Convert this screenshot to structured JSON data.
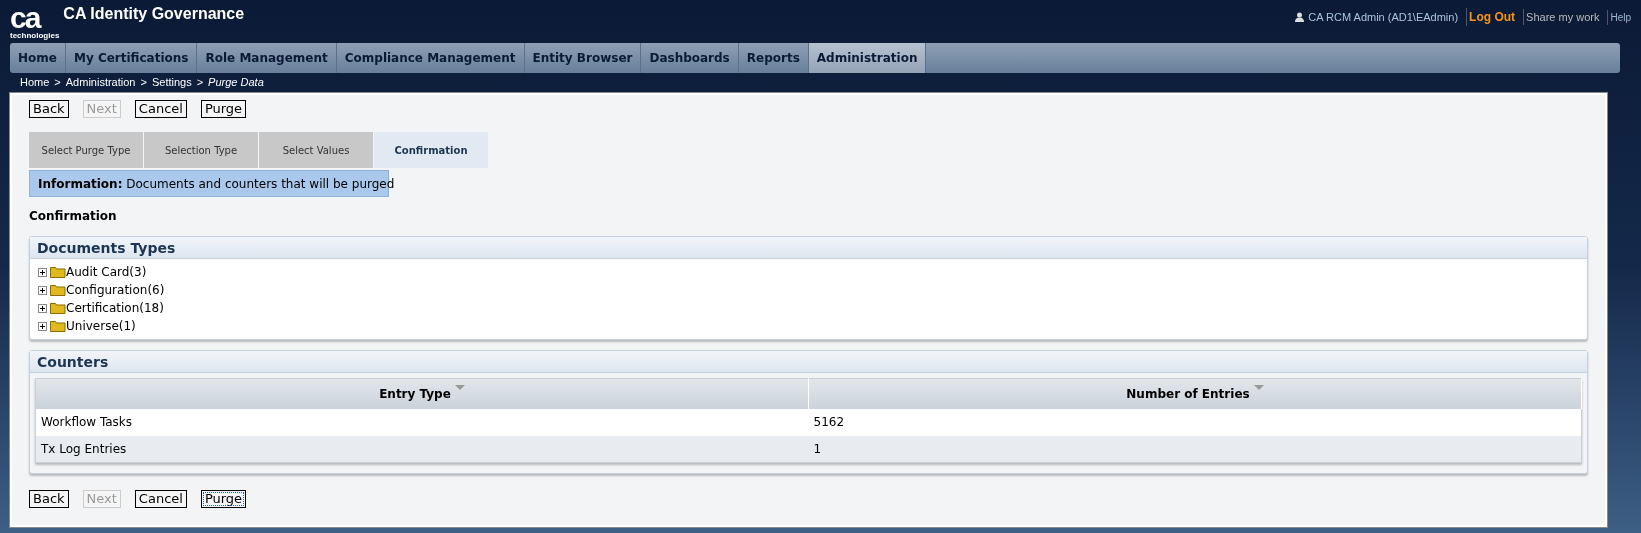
{
  "header": {
    "logo_mark": "ca",
    "logo_sub": "technologies",
    "title": "CA Identity Governance",
    "user": "CA RCM Admin (AD1\\EAdmin)",
    "links": [
      {
        "label": "Log Out",
        "kind": "primary"
      },
      {
        "label": "Share my work",
        "kind": "plain"
      },
      {
        "label": "Help",
        "kind": "small"
      }
    ]
  },
  "nav": [
    {
      "label": "Home",
      "selected": false
    },
    {
      "label": "My Certifications",
      "selected": false
    },
    {
      "label": "Role Management",
      "selected": false
    },
    {
      "label": "Compliance Management",
      "selected": false
    },
    {
      "label": "Entity Browser",
      "selected": false
    },
    {
      "label": "Dashboards",
      "selected": false
    },
    {
      "label": "Reports",
      "selected": false
    },
    {
      "label": "Administration",
      "selected": true
    }
  ],
  "breadcrumb": [
    {
      "label": "Home",
      "current": false
    },
    {
      "label": "Administration",
      "current": false
    },
    {
      "label": "Settings",
      "current": false
    },
    {
      "label": "Purge Data",
      "current": true
    }
  ],
  "breadcrumb_separator": ">",
  "top_buttons": [
    {
      "label": "Back",
      "disabled": false,
      "focused": false
    },
    {
      "label": "Next",
      "disabled": true,
      "focused": false
    },
    {
      "label": "Cancel",
      "disabled": false,
      "focused": false
    },
    {
      "label": "Purge",
      "disabled": false,
      "focused": false
    }
  ],
  "steps": [
    {
      "label": "Select Purge Type",
      "selected": false
    },
    {
      "label": "Selection Type",
      "selected": false
    },
    {
      "label": "Select Values",
      "selected": false
    },
    {
      "label": "Confirmation",
      "selected": true
    }
  ],
  "info": {
    "label": "Information:",
    "text": "Documents and counters that will be purged"
  },
  "section_title": "Confirmation",
  "documents": {
    "title": "Documents Types",
    "items": [
      {
        "label": "Audit Card(3)",
        "expanded": false
      },
      {
        "label": "Configuration(6)",
        "expanded": false
      },
      {
        "label": "Certification(18)",
        "expanded": false
      },
      {
        "label": "Universe(1)",
        "expanded": false
      }
    ]
  },
  "counters": {
    "title": "Counters",
    "columns": [
      "Entry Type",
      "Number of Entries"
    ],
    "rows": [
      [
        "Workflow Tasks",
        "5162"
      ],
      [
        "Tx Log Entries",
        "1"
      ]
    ]
  },
  "bottom_buttons": [
    {
      "label": "Back",
      "disabled": false,
      "focused": false
    },
    {
      "label": "Next",
      "disabled": true,
      "focused": false
    },
    {
      "label": "Cancel",
      "disabled": false,
      "focused": false
    },
    {
      "label": "Purge",
      "disabled": false,
      "focused": true
    }
  ]
}
